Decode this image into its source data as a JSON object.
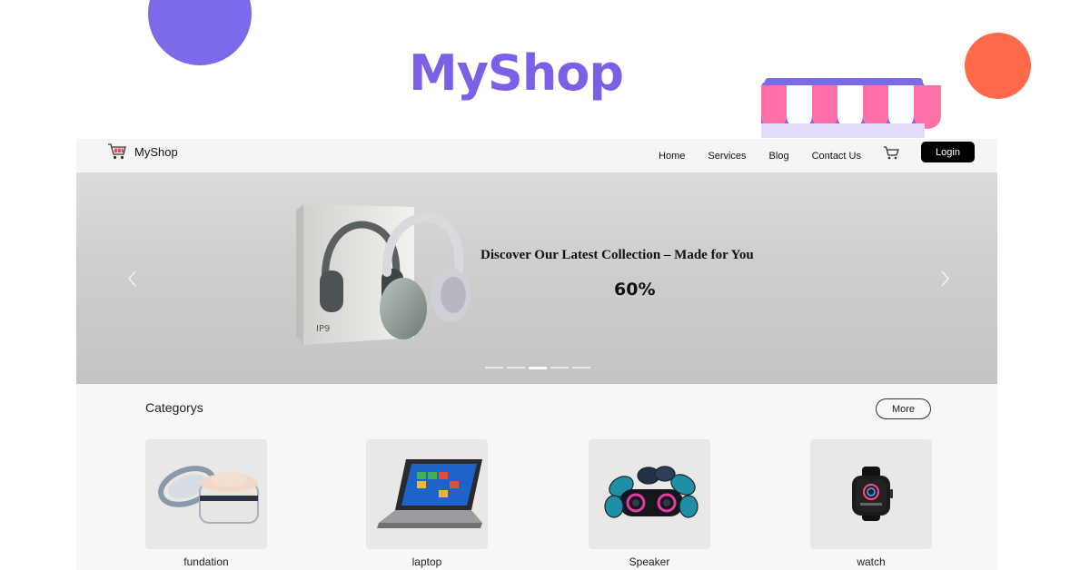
{
  "promo": {
    "title": "MyShop"
  },
  "navbar": {
    "brand": "MyShop",
    "links": [
      "Home",
      "Services",
      "Blog",
      "Contact Us"
    ],
    "login_label": "Login"
  },
  "hero": {
    "headline": "Discover Our Latest Collection – Made for You",
    "discount": "60%",
    "slides_total": 5,
    "active_slide": 3
  },
  "categories": {
    "title": "Categorys",
    "more_label": "More",
    "items": [
      {
        "label": "fundation",
        "icon": "cosmetic-jar-icon"
      },
      {
        "label": "laptop",
        "icon": "laptop-icon"
      },
      {
        "label": "Speaker",
        "icon": "speaker-icon"
      },
      {
        "label": "watch",
        "icon": "smartwatch-icon"
      }
    ]
  },
  "colors": {
    "brand_purple": "#7b5fe6",
    "deco_purple": "#7b6be8",
    "deco_orange": "#ff6b4a",
    "awning_pink": "#ff6fa8",
    "login_bg": "#000000"
  }
}
